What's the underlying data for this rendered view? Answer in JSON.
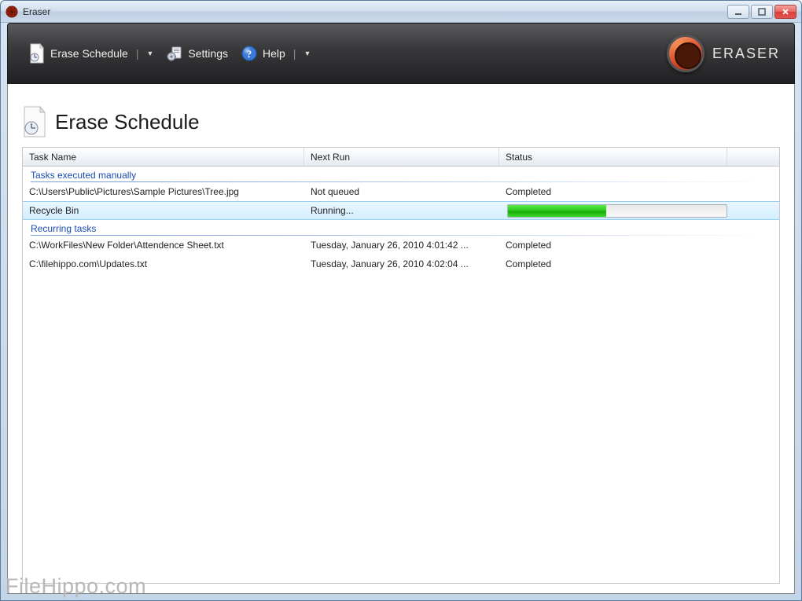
{
  "window": {
    "title": "Eraser"
  },
  "brand": {
    "text": "ERASER"
  },
  "toolbar": {
    "erase_schedule": "Erase Schedule",
    "settings": "Settings",
    "help": "Help"
  },
  "page": {
    "title": "Erase Schedule"
  },
  "columns": {
    "task_name": "Task Name",
    "next_run": "Next Run",
    "status": "Status"
  },
  "groups": {
    "manual": "Tasks executed manually",
    "recurring": "Recurring tasks"
  },
  "tasks": {
    "manual": [
      {
        "name": "C:\\Users\\Public\\Pictures\\Sample Pictures\\Tree.jpg",
        "next_run": "Not queued",
        "status": "Completed"
      },
      {
        "name": "Recycle Bin",
        "next_run": "Running...",
        "status_type": "progress",
        "progress": 45
      }
    ],
    "recurring": [
      {
        "name": "C:\\WorkFiles\\New Folder\\Attendence Sheet.txt",
        "next_run": "Tuesday, January 26, 2010 4:01:42 ...",
        "status": "Completed"
      },
      {
        "name": "C:\\filehippo.com\\Updates.txt",
        "next_run": "Tuesday, January 26, 2010 4:02:04 ...",
        "status": "Completed"
      }
    ]
  },
  "watermark": "FileHippo.com"
}
